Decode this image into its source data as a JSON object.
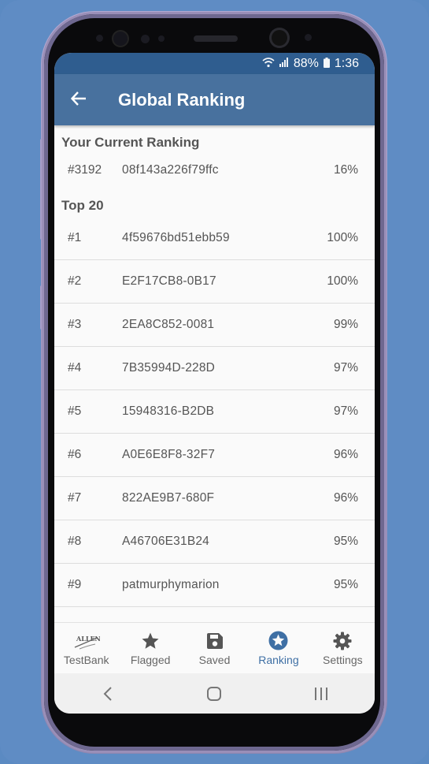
{
  "status": {
    "battery": "88%",
    "time": "1:36"
  },
  "appbar": {
    "title": "Global Ranking"
  },
  "current": {
    "heading": "Your Current Ranking",
    "rank": "#3192",
    "id": "08f143a226f79ffc",
    "pct": "16%"
  },
  "top": {
    "heading": "Top 20",
    "rows": [
      {
        "rank": "#1",
        "id": "4f59676bd51ebb59",
        "pct": "100%"
      },
      {
        "rank": "#2",
        "id": "E2F17CB8-0B17",
        "pct": "100%"
      },
      {
        "rank": "#3",
        "id": "2EA8C852-0081",
        "pct": "99%"
      },
      {
        "rank": "#4",
        "id": "7B35994D-228D",
        "pct": "97%"
      },
      {
        "rank": "#5",
        "id": "15948316-B2DB",
        "pct": "97%"
      },
      {
        "rank": "#6",
        "id": "A0E6E8F8-32F7",
        "pct": "96%"
      },
      {
        "rank": "#7",
        "id": "822AE9B7-680F",
        "pct": "96%"
      },
      {
        "rank": "#8",
        "id": "A46706E31B24",
        "pct": "95%"
      },
      {
        "rank": "#9",
        "id": "patmurphymarion",
        "pct": "95%"
      }
    ]
  },
  "tabs": {
    "testbank": "TestBank",
    "flagged": "Flagged",
    "saved": "Saved",
    "ranking": "Ranking",
    "settings": "Settings"
  },
  "logo": {
    "text": "ALLEN"
  },
  "colors": {
    "background": "#5f8cc4",
    "statusbar": "#2f5d8f",
    "appbar": "#48719e",
    "active_tab": "#3e6fa4",
    "text": "#555555"
  },
  "icons": {
    "back": "arrow-left-icon",
    "wifi": "wifi-icon",
    "signal": "signal-icon",
    "battery": "battery-icon",
    "flagged": "star-icon",
    "saved": "save-icon",
    "ranking": "star-circle-icon",
    "settings": "gear-icon",
    "nav_back": "chevron-left-icon",
    "nav_home": "home-square-icon",
    "nav_recents": "recents-icon"
  }
}
